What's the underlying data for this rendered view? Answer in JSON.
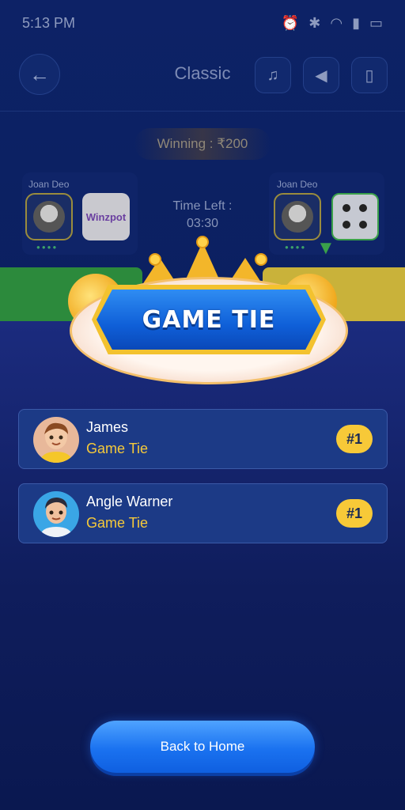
{
  "status_bar": {
    "time": "5:13 PM",
    "icons": [
      "alarm-icon",
      "bluetooth-icon",
      "wifi-icon",
      "signal-icon",
      "battery-icon"
    ]
  },
  "header": {
    "title": "Classic",
    "buttons": [
      "music-icon",
      "volume-icon",
      "vibrate-icon"
    ]
  },
  "game": {
    "winning": "Winning : ₹200",
    "time_left_label": "Time Left :",
    "time_left_value": "03:30",
    "players": [
      {
        "name": "Joan Deo"
      },
      {
        "name": "Joan Deo"
      }
    ],
    "brand_logo": "Winzpot"
  },
  "result": {
    "title": "GAME TIE",
    "rows": [
      {
        "name": "James",
        "status": "Game Tie",
        "rank": "#1"
      },
      {
        "name": "Angle Warner",
        "status": "Game Tie",
        "rank": "#1"
      }
    ]
  },
  "cta": {
    "label": "Back to Home"
  },
  "colors": {
    "panel_bg": "#1b2b7e",
    "accent_yellow": "#f5c93a",
    "button_blue": "#1a72f0"
  }
}
